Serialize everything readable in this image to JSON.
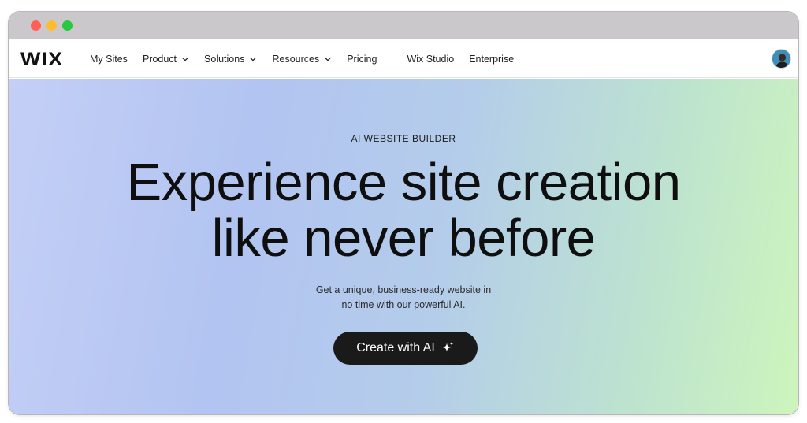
{
  "window": {
    "controls": [
      "close",
      "minimize",
      "zoom"
    ]
  },
  "navbar": {
    "logo": "WIX",
    "items": [
      {
        "label": "My Sites",
        "has_dropdown": false
      },
      {
        "label": "Product",
        "has_dropdown": true
      },
      {
        "label": "Solutions",
        "has_dropdown": true
      },
      {
        "label": "Resources",
        "has_dropdown": true
      },
      {
        "label": "Pricing",
        "has_dropdown": false
      }
    ],
    "secondary_items": [
      {
        "label": "Wix Studio"
      },
      {
        "label": "Enterprise"
      }
    ],
    "avatar_icon": "user-avatar-icon"
  },
  "hero": {
    "eyebrow": "AI WEBSITE BUILDER",
    "headline_line1": "Experience site creation",
    "headline_line2": "like never before",
    "subtitle_line1": "Get a unique, business-ready website in",
    "subtitle_line2": "no time with our powerful AI.",
    "cta_label": "Create with AI",
    "cta_icon": "sparkle-icon"
  },
  "colors": {
    "cta_background": "#1a1a1a",
    "gradient_start": "#c4cff6",
    "gradient_end": "#cdf5bc"
  }
}
